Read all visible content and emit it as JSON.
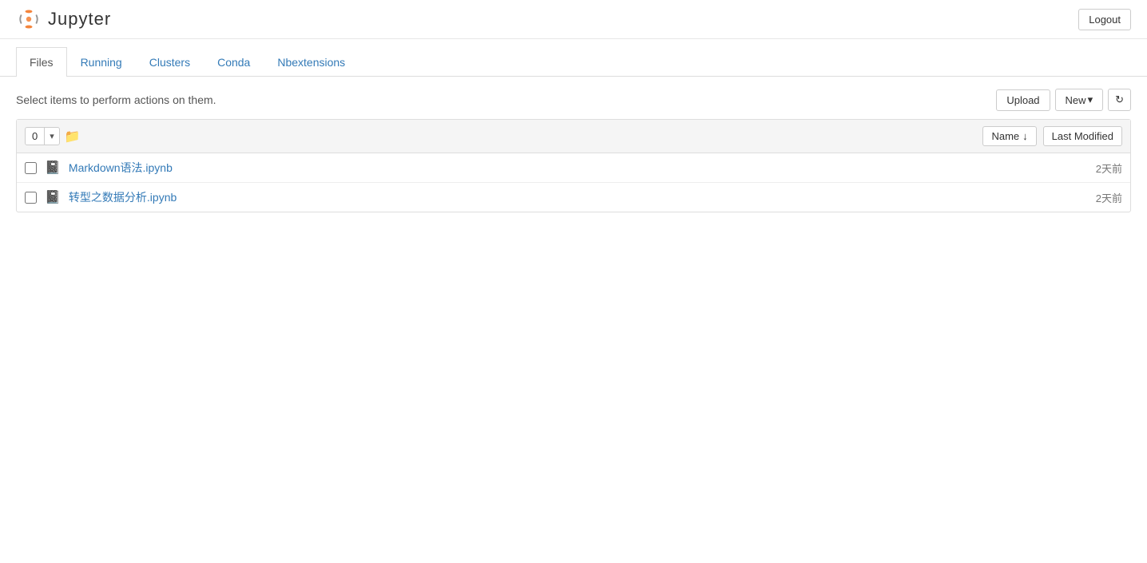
{
  "header": {
    "title": "Jupyter",
    "logout_label": "Logout"
  },
  "tabs": [
    {
      "id": "files",
      "label": "Files",
      "active": true
    },
    {
      "id": "running",
      "label": "Running",
      "active": false
    },
    {
      "id": "clusters",
      "label": "Clusters",
      "active": false
    },
    {
      "id": "conda",
      "label": "Conda",
      "active": false
    },
    {
      "id": "nbextensions",
      "label": "Nbextensions",
      "active": false
    }
  ],
  "toolbar": {
    "select_info": "Select items to perform actions on them.",
    "upload_label": "Upload",
    "new_label": "New",
    "new_dropdown_arrow": "▾",
    "refresh_icon": "↻",
    "select_count": "0",
    "select_dropdown_arrow": "▾"
  },
  "file_list": {
    "header_name": "Name",
    "header_name_arrow": "↓",
    "header_lastmod": "Last Modified",
    "files": [
      {
        "id": "file-1",
        "name": "Markdown语法.ipynb",
        "modified": "2天前"
      },
      {
        "id": "file-2",
        "name": "转型之数据分析.ipynb",
        "modified": "2天前"
      }
    ]
  }
}
